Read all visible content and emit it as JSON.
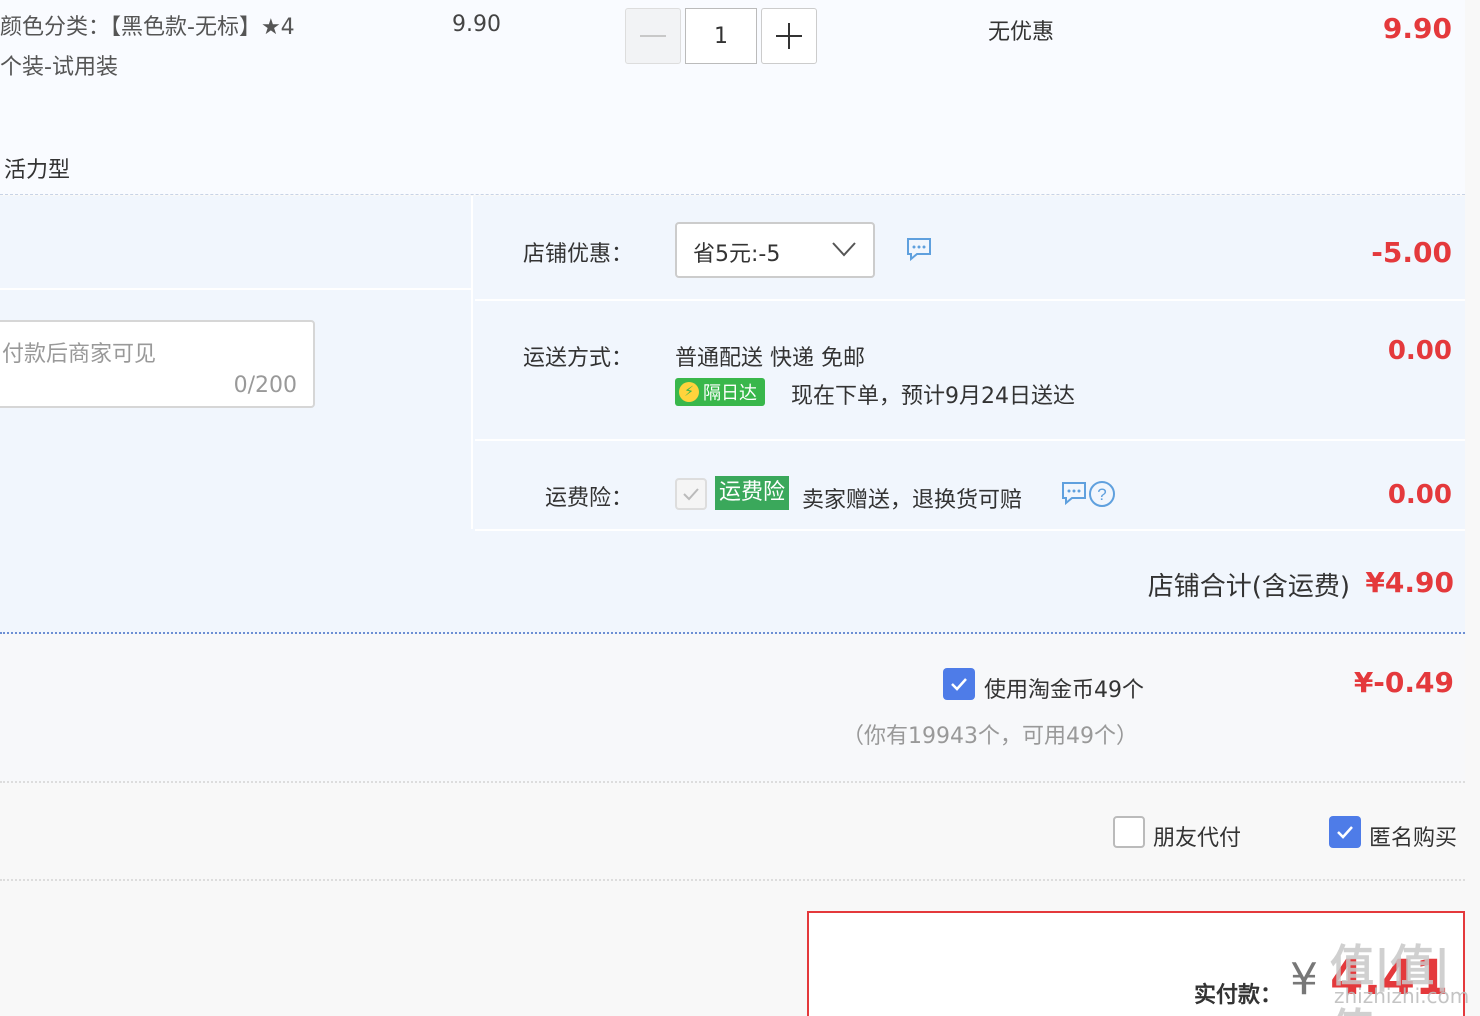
{
  "product": {
    "sku_line1": "颜色分类：【黑色款-无标】★4",
    "sku_line2": "个装-试用装",
    "unit_price": "9.90",
    "quantity": "1",
    "discount": "无优惠",
    "subtotal": "9.90",
    "style_tag": "活力型"
  },
  "memo": {
    "placeholder": "付款后商家可见",
    "counter": "0/200"
  },
  "shop_discount": {
    "label": "店铺优惠：",
    "selected": "省5元:-5",
    "amount": "-5.00"
  },
  "shipping": {
    "label": "运送方式：",
    "method": "普通配送 快递 免邮",
    "badge": "隔日达",
    "eta": "现在下单，预计9月24日送达",
    "amount": "0.00"
  },
  "insurance": {
    "label": "运费险：",
    "tag": "运费险",
    "desc": "卖家赠送，退换货可赔",
    "amount": "0.00"
  },
  "shop_total": {
    "label": "店铺合计(含运费)",
    "amount": "¥4.90"
  },
  "coins": {
    "label": "使用淘金币49个",
    "hint": "（你有19943个，可用49个）",
    "amount": "¥-0.49"
  },
  "options": {
    "friend_pay": "朋友代付",
    "anonymous": "匿名购买"
  },
  "payment": {
    "label": "实付款：",
    "currency": "¥",
    "amount": "4.41"
  },
  "watermark": {
    "logo": "值|值|值",
    "site": "zhizhizhi.com"
  },
  "colors": {
    "accent_red": "#e4393c",
    "checkbox_blue": "#4e7ce8",
    "tag_green": "#39b74b"
  }
}
